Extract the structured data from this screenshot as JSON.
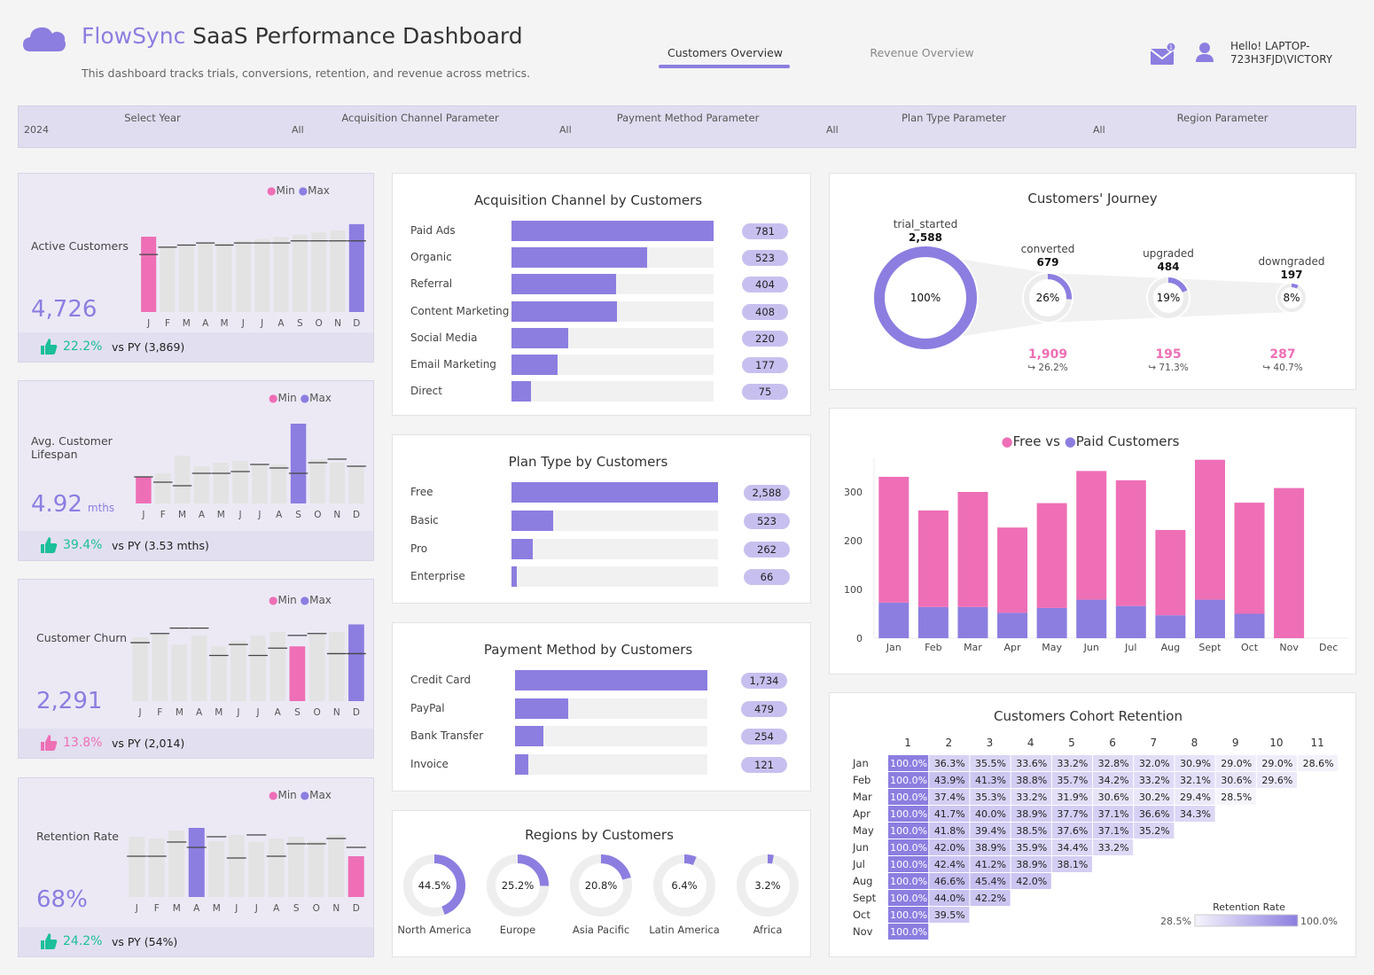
{
  "header": {
    "brand": "FlowSync",
    "title_rest": " SaaS Performance Dashboard",
    "subtitle": "This dashboard tracks trials, conversions, retention, and revenue across metrics.",
    "tabs": [
      {
        "label": "Customers Overview",
        "active": true
      },
      {
        "label": "Revenue Overview",
        "active": false
      }
    ],
    "greeting_line1": "Hello! LAPTOP-",
    "greeting_line2": "723H3FJD\\VICTORY",
    "notification_count": "1"
  },
  "filters": [
    {
      "label": "Select Year",
      "value": "2024"
    },
    {
      "label": "Acquisition Channel Parameter",
      "value": "All"
    },
    {
      "label": "Payment Method Parameter",
      "value": "All"
    },
    {
      "label": "Plan Type Parameter",
      "value": "All"
    },
    {
      "label": "Region Parameter",
      "value": "All"
    }
  ],
  "months_short": [
    "J",
    "F",
    "M",
    "A",
    "M",
    "J",
    "J",
    "A",
    "S",
    "O",
    "N",
    "D"
  ],
  "kpi_legend": {
    "min": "Min",
    "max": "Max"
  },
  "kpis": [
    {
      "title": "Active Customers",
      "value": "4,726",
      "unit": "",
      "pct": "22.2%",
      "trend": "up",
      "py": "vs PY (3,869)",
      "bars": [
        0.72,
        0.62,
        0.64,
        0.66,
        0.66,
        0.68,
        0.7,
        0.72,
        0.74,
        0.76,
        0.78,
        0.84
      ],
      "marks": [
        0.55,
        0.62,
        0.64,
        0.66,
        0.64,
        0.66,
        0.66,
        0.66,
        0.68,
        0.68,
        0.68,
        0.68
      ],
      "min": 0,
      "max": 11
    },
    {
      "title": "Avg. Customer Lifespan",
      "value": "4.92",
      "unit": "mths",
      "pct": "39.4%",
      "trend": "up",
      "py": "vs PY (3.53 mths)",
      "bars": [
        0.3,
        0.34,
        0.54,
        0.42,
        0.46,
        0.48,
        0.44,
        0.44,
        0.9,
        0.5,
        0.46,
        0.42
      ],
      "marks": [
        0.3,
        0.24,
        0.2,
        0.34,
        0.34,
        0.36,
        0.44,
        0.4,
        0.34,
        0.46,
        0.5,
        0.42
      ],
      "min": 0,
      "max": 8
    },
    {
      "title": "Customer Churn",
      "value": "2,291",
      "unit": "",
      "pct": "13.8%",
      "trend": "down",
      "py": "vs PY (2,014)",
      "bars": [
        0.7,
        0.74,
        0.62,
        0.72,
        0.6,
        0.66,
        0.72,
        0.76,
        0.6,
        0.74,
        0.76,
        0.84
      ],
      "marks": [
        0.64,
        0.74,
        0.8,
        0.8,
        0.5,
        0.62,
        0.5,
        0.58,
        0.72,
        0.74,
        0.52,
        0.52
      ],
      "min": 8,
      "max": 11
    },
    {
      "title": "Retention Rate",
      "value": "68%",
      "unit": "",
      "pct": "24.2%",
      "trend": "up",
      "py": "vs PY (54%)",
      "bars": [
        0.68,
        0.66,
        0.75,
        0.78,
        0.63,
        0.7,
        0.62,
        0.66,
        0.68,
        0.63,
        0.7,
        0.46
      ],
      "marks": [
        0.46,
        0.46,
        0.62,
        0.56,
        0.68,
        0.44,
        0.7,
        0.46,
        0.6,
        0.6,
        0.66,
        0.56
      ],
      "min": 11,
      "max": 3
    }
  ],
  "acquisition": {
    "title": "Acquisition Channel by Customers",
    "items": [
      {
        "label": "Paid Ads",
        "value": 781,
        "display": "781"
      },
      {
        "label": "Organic",
        "value": 523,
        "display": "523"
      },
      {
        "label": "Referral",
        "value": 404,
        "display": "404"
      },
      {
        "label": "Content Marketing",
        "value": 408,
        "display": "408"
      },
      {
        "label": "Social Media",
        "value": 220,
        "display": "220"
      },
      {
        "label": "Email Marketing",
        "value": 177,
        "display": "177"
      },
      {
        "label": "Direct",
        "value": 75,
        "display": "75"
      }
    ]
  },
  "plan": {
    "title": "Plan Type by Customers",
    "items": [
      {
        "label": "Free",
        "value": 2588,
        "display": "2,588"
      },
      {
        "label": "Basic",
        "value": 523,
        "display": "523"
      },
      {
        "label": "Pro",
        "value": 262,
        "display": "262"
      },
      {
        "label": "Enterprise",
        "value": 66,
        "display": "66"
      }
    ]
  },
  "payment": {
    "title": "Payment Method by Customers",
    "items": [
      {
        "label": "Credit Card",
        "value": 1734,
        "display": "1,734"
      },
      {
        "label": "PayPal",
        "value": 479,
        "display": "479"
      },
      {
        "label": "Bank Transfer",
        "value": 254,
        "display": "254"
      },
      {
        "label": "Invoice",
        "value": 121,
        "display": "121"
      }
    ]
  },
  "regions": {
    "title": "Regions by Customers",
    "items": [
      {
        "label": "North America",
        "pct": 44.5,
        "display": "44.5%"
      },
      {
        "label": "Europe",
        "pct": 25.2,
        "display": "25.2%"
      },
      {
        "label": "Asia Pacific",
        "pct": 20.8,
        "display": "20.8%"
      },
      {
        "label": "Latin America",
        "pct": 6.4,
        "display": "6.4%"
      },
      {
        "label": "Africa",
        "pct": 3.2,
        "display": "3.2%"
      }
    ]
  },
  "journey": {
    "title": "Customers' Journey",
    "stages": [
      {
        "name": "trial_started",
        "count": "2,588",
        "pct": 100,
        "pct_label": "100%"
      },
      {
        "name": "converted",
        "count": "679",
        "pct": 26,
        "pct_label": "26%",
        "drop": "1,909",
        "drop_pct": "26.2%"
      },
      {
        "name": "upgraded",
        "count": "484",
        "pct": 19,
        "pct_label": "19%",
        "drop": "195",
        "drop_pct": "71.3%"
      },
      {
        "name": "downgraded",
        "count": "197",
        "pct": 8,
        "pct_label": "8%",
        "drop": "287",
        "drop_pct": "40.7%"
      }
    ]
  },
  "free_paid": {
    "title_free": "Free",
    "title_mid": " vs ",
    "title_paid": "Paid Customers",
    "colors": {
      "free": "#ee6fb6",
      "paid": "#8b7ee0"
    }
  },
  "chart_data": {
    "type": "bar",
    "stacked": true,
    "categories": [
      "Jan",
      "Feb",
      "Mar",
      "Apr",
      "May",
      "Jun",
      "Jul",
      "Aug",
      "Sept",
      "Oct",
      "Nov",
      "Dec"
    ],
    "series": [
      {
        "name": "Paid Customers",
        "values": [
          73,
          64,
          64,
          52,
          62,
          79,
          66,
          47,
          79,
          50,
          0,
          0
        ]
      },
      {
        "name": "Free",
        "values": [
          258,
          198,
          236,
          175,
          215,
          264,
          258,
          175,
          287,
          228,
          308,
          0
        ]
      }
    ],
    "yticks": [
      0,
      100,
      200,
      300
    ],
    "ylim": [
      0,
      380
    ],
    "legend_placement": "top",
    "grid": false
  },
  "cohort": {
    "title": "Customers Cohort Retention",
    "columns": [
      "1",
      "2",
      "3",
      "4",
      "5",
      "6",
      "7",
      "8",
      "9",
      "10",
      "11"
    ],
    "rows": [
      {
        "month": "Jan",
        "cells": [
          "100.0%",
          "36.3%",
          "35.5%",
          "33.6%",
          "33.2%",
          "32.8%",
          "32.0%",
          "30.9%",
          "29.0%",
          "29.0%",
          "28.6%"
        ]
      },
      {
        "month": "Feb",
        "cells": [
          "100.0%",
          "43.9%",
          "41.3%",
          "38.8%",
          "35.7%",
          "34.2%",
          "33.2%",
          "32.1%",
          "30.6%",
          "29.6%"
        ]
      },
      {
        "month": "Mar",
        "cells": [
          "100.0%",
          "37.4%",
          "35.3%",
          "33.2%",
          "31.9%",
          "30.6%",
          "30.2%",
          "29.4%",
          "28.5%"
        ]
      },
      {
        "month": "Apr",
        "cells": [
          "100.0%",
          "41.7%",
          "40.0%",
          "38.9%",
          "37.7%",
          "37.1%",
          "36.6%",
          "34.3%"
        ]
      },
      {
        "month": "May",
        "cells": [
          "100.0%",
          "41.8%",
          "39.4%",
          "38.5%",
          "37.6%",
          "37.1%",
          "35.2%"
        ]
      },
      {
        "month": "Jun",
        "cells": [
          "100.0%",
          "42.0%",
          "38.9%",
          "35.9%",
          "34.4%",
          "33.2%"
        ]
      },
      {
        "month": "Jul",
        "cells": [
          "100.0%",
          "42.4%",
          "41.2%",
          "38.9%",
          "38.1%"
        ]
      },
      {
        "month": "Aug",
        "cells": [
          "100.0%",
          "46.6%",
          "45.4%",
          "42.0%"
        ]
      },
      {
        "month": "Sept",
        "cells": [
          "100.0%",
          "44.0%",
          "42.2%"
        ]
      },
      {
        "month": "Oct",
        "cells": [
          "100.0%",
          "39.5%"
        ]
      },
      {
        "month": "Nov",
        "cells": [
          "100.0%"
        ]
      }
    ],
    "legend_title": "Retention Rate",
    "legend_min": "28.5%",
    "legend_max": "100.0%"
  }
}
